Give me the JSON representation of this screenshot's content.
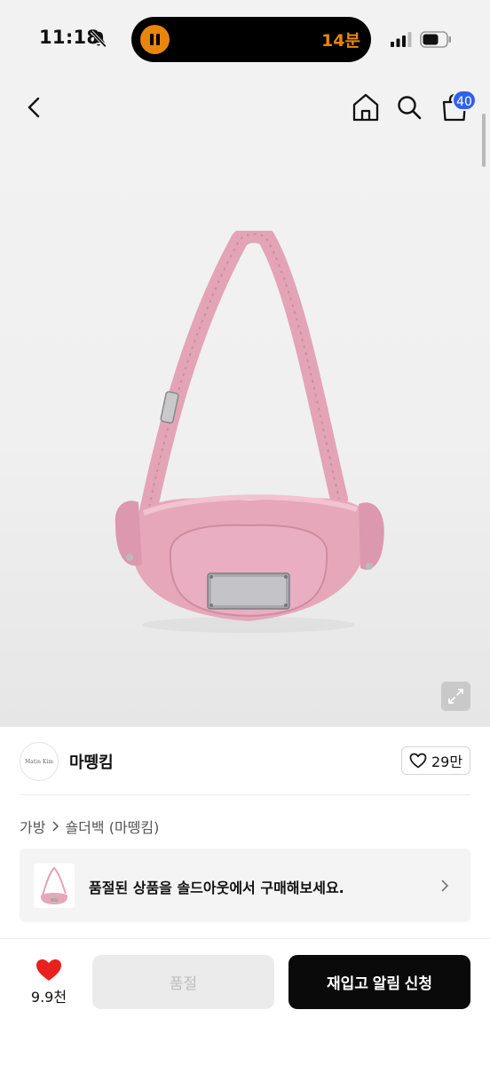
{
  "status_bar": {
    "time": "11:18",
    "timer_text": "14분",
    "accent_color": "#e8860c"
  },
  "nav": {
    "back_icon": "chevron-left-icon",
    "home_icon": "home-icon",
    "search_icon": "search-icon",
    "bag_icon": "shopping-bag-icon",
    "cart_count": "40",
    "badge_color": "#2e62e8"
  },
  "product": {
    "image_alt": "pink shoulder bag",
    "image_color": "#e6a7bb",
    "expand_icon": "expand-icon"
  },
  "brand": {
    "logo_text": "Matin Kim",
    "name": "마뗑킴",
    "wish_count": "29만"
  },
  "breadcrumb": {
    "category": "가방",
    "subcategory": "숄더백 (마뗑킴)"
  },
  "promo": {
    "text": "품절된 상품을 솔드아웃에서 구매해보세요."
  },
  "bottom_bar": {
    "like_count": "9.9천",
    "heart_color": "#e8211f",
    "soldout_label": "품절",
    "restock_label": "재입고 알림 신청"
  }
}
